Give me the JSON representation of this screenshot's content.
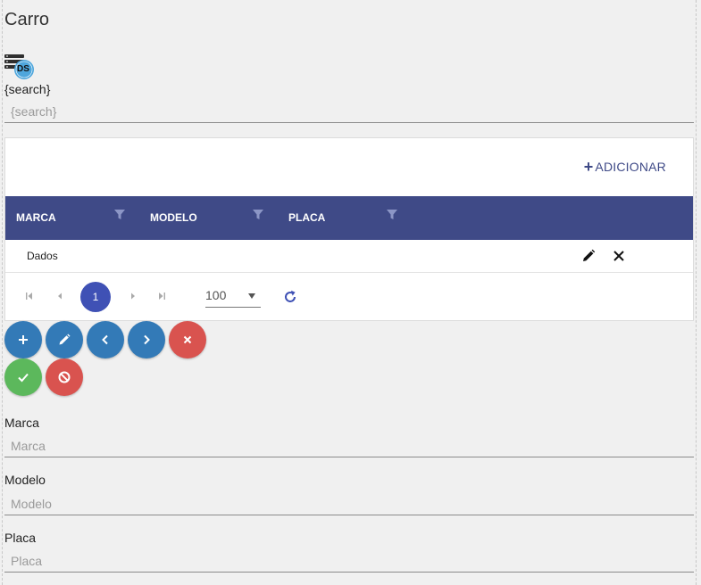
{
  "page": {
    "title": "Carro"
  },
  "datasource": {
    "badge": "DS",
    "icon": "datasource-icon"
  },
  "search": {
    "label": "{search}",
    "placeholder": "{search}",
    "value": ""
  },
  "grid": {
    "add_label": "ADICIONAR",
    "columns": [
      "MARCA",
      "MODELO",
      "PLACA"
    ],
    "rows": [
      {
        "text": "Dados"
      }
    ],
    "pagination": {
      "current_page": "1",
      "page_size": "100"
    }
  },
  "actions": {
    "row1": [
      "add",
      "edit",
      "previous",
      "next",
      "delete"
    ],
    "row2": [
      "save",
      "cancel"
    ],
    "colors": {
      "blue": "#337ab7",
      "red": "#d9534f",
      "green": "#5cb85c"
    }
  },
  "form": {
    "marca": {
      "label": "Marca",
      "placeholder": "Marca",
      "value": ""
    },
    "modelo": {
      "label": "Modelo",
      "placeholder": "Modelo",
      "value": ""
    },
    "placa": {
      "label": "Placa",
      "placeholder": "Placa",
      "value": ""
    }
  },
  "colors": {
    "header": "#3f4a87",
    "page_active": "#3f51b5",
    "accent": "#3f4a87"
  }
}
